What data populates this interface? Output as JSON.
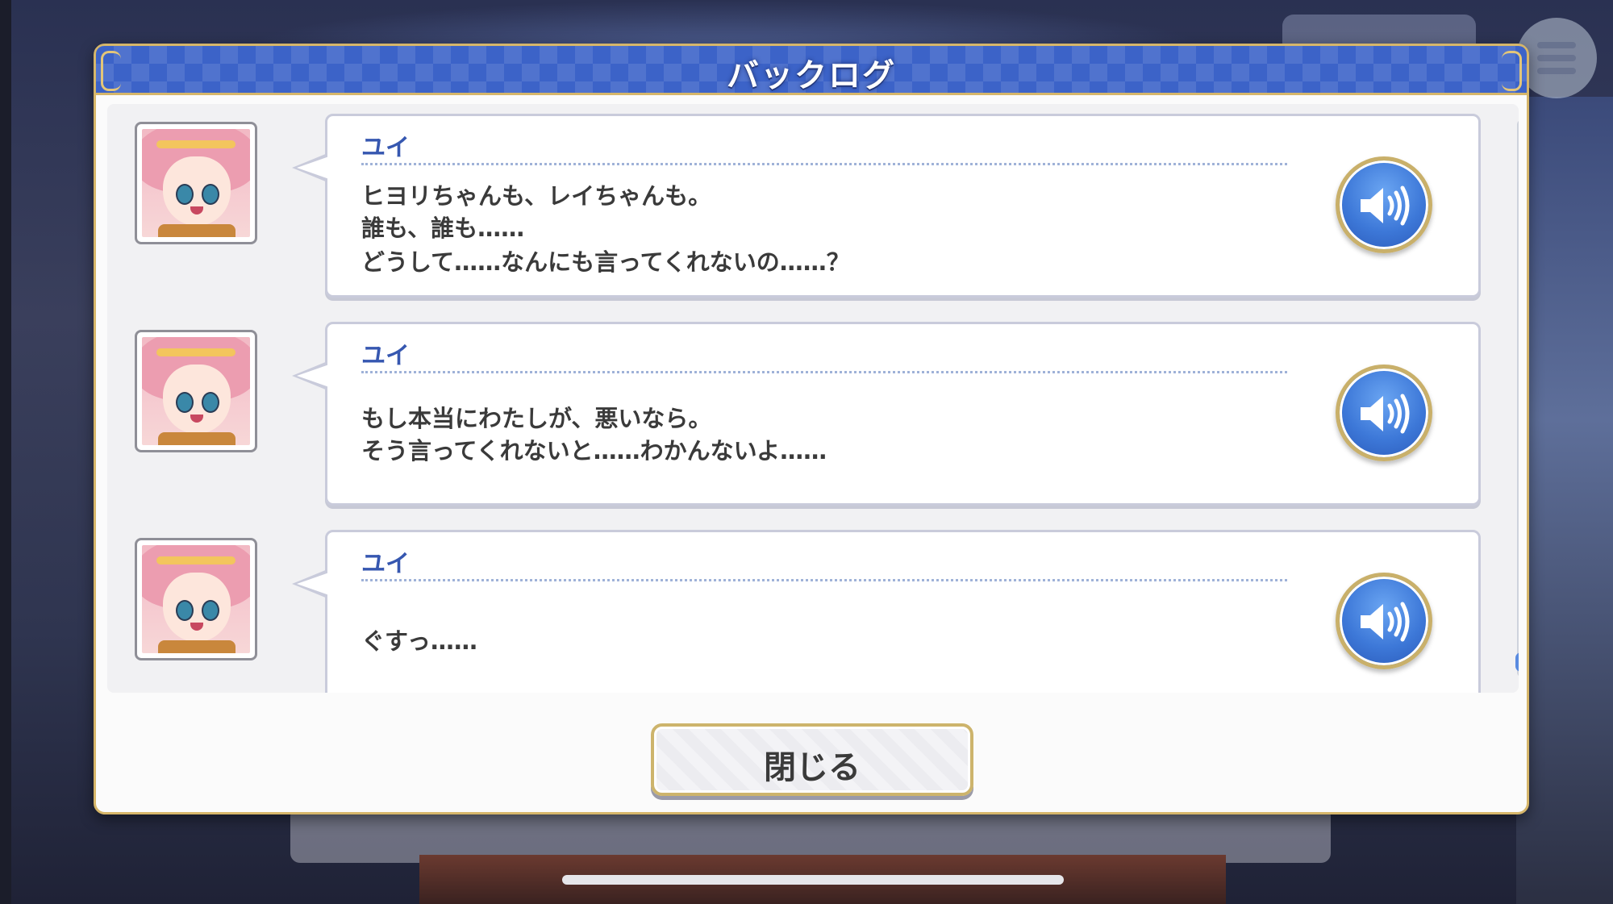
{
  "dialog": {
    "title": "バックログ",
    "close_label": "閉じる"
  },
  "entries": [
    {
      "speaker": "ユイ",
      "lines": [
        "ヒヨリちゃんも、レイちゃんも。",
        "誰も、誰も……",
        "どうして……なんにも言ってくれないの……？"
      ],
      "avatar_icon": "character-portrait-icon",
      "voice_icon": "speaker-volume-icon"
    },
    {
      "speaker": "ユイ",
      "lines": [
        "もし本当にわたしが、悪いなら。",
        "そう言ってくれないと……わかんないよ……"
      ],
      "avatar_icon": "character-portrait-icon",
      "voice_icon": "speaker-volume-icon"
    },
    {
      "speaker": "ユイ",
      "lines": [
        "ぐすっ……"
      ],
      "avatar_icon": "character-portrait-icon",
      "voice_icon": "speaker-volume-icon"
    }
  ],
  "colors": {
    "header_blue": "#3c63c8",
    "gold_border": "#d6b66a",
    "speaker_name": "#3657b0",
    "voice_button": "#3d78d8"
  }
}
